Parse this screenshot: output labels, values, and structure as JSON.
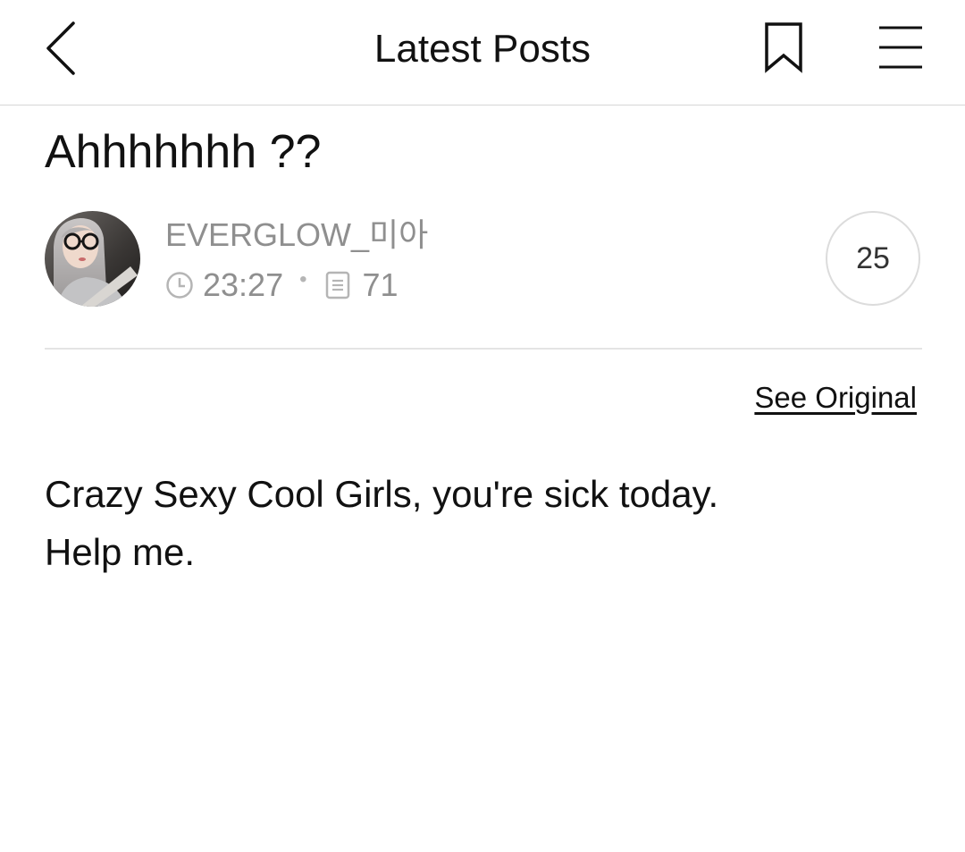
{
  "header": {
    "title": "Latest Posts",
    "back_icon": "chevron-left-icon",
    "bookmark_icon": "bookmark-icon",
    "menu_icon": "hamburger-menu-icon"
  },
  "post": {
    "title": "Ahhhhhhh ??",
    "author": {
      "name": "EVERGLOW_미아",
      "avatar": "user-avatar-photo"
    },
    "time": "23:27",
    "time_icon": "clock-icon",
    "views": "71",
    "views_icon": "document-icon",
    "comment_count": "25",
    "see_original_label": "See Original",
    "body_lines": [
      "Crazy Sexy Cool Girls, you're sick today.",
      "Help me."
    ]
  },
  "colors": {
    "text_primary": "#111111",
    "text_muted": "#8f8f8f",
    "divider": "#e4e4e4"
  }
}
